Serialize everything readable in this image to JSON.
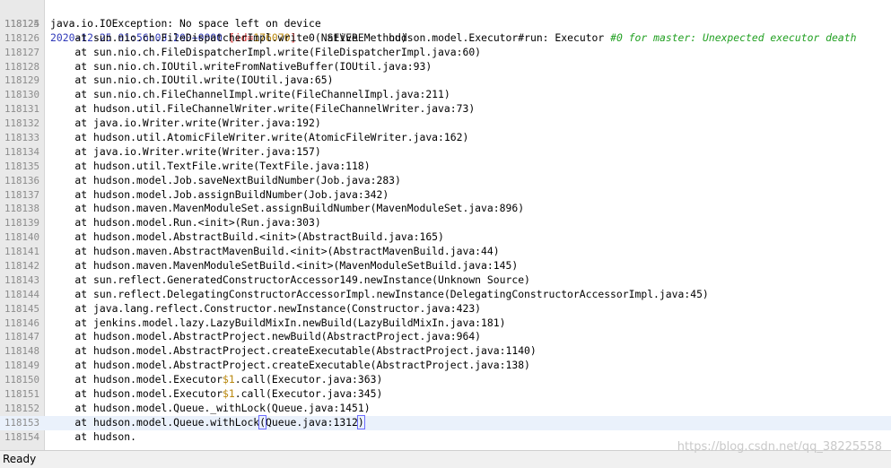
{
  "status": {
    "text": "Ready"
  },
  "watermark": "https://blog.csdn.net/qq_38225558",
  "header_line": {
    "num": "118124",
    "date": "2020-12-25 01:56:03.200+0000",
    "id_open": "[",
    "id_label": "id",
    "id_eq": "=",
    "id_value": "176070",
    "id_close": "]",
    "severity": "SEVERE",
    "source": "hudson.model.Executor#run: Executor ",
    "message": "#0 for master: Unexpected executor death"
  },
  "lines": [
    {
      "num": "118125",
      "code": "java.io.IOException: No space left on device"
    },
    {
      "num": "118126",
      "code": "    at sun.nio.ch.FileDispatcherImpl.write0(Native Method)"
    },
    {
      "num": "118127",
      "code": "    at sun.nio.ch.FileDispatcherImpl.write(FileDispatcherImpl.java:60)"
    },
    {
      "num": "118128",
      "code": "    at sun.nio.ch.IOUtil.writeFromNativeBuffer(IOUtil.java:93)"
    },
    {
      "num": "118129",
      "code": "    at sun.nio.ch.IOUtil.write(IOUtil.java:65)"
    },
    {
      "num": "118130",
      "code": "    at sun.nio.ch.FileChannelImpl.write(FileChannelImpl.java:211)"
    },
    {
      "num": "118131",
      "code": "    at hudson.util.FileChannelWriter.write(FileChannelWriter.java:73)"
    },
    {
      "num": "118132",
      "code": "    at java.io.Writer.write(Writer.java:192)"
    },
    {
      "num": "118133",
      "code": "    at hudson.util.AtomicFileWriter.write(AtomicFileWriter.java:162)"
    },
    {
      "num": "118134",
      "code": "    at java.io.Writer.write(Writer.java:157)"
    },
    {
      "num": "118135",
      "code": "    at hudson.util.TextFile.write(TextFile.java:118)"
    },
    {
      "num": "118136",
      "code": "    at hudson.model.Job.saveNextBuildNumber(Job.java:283)"
    },
    {
      "num": "118137",
      "code": "    at hudson.model.Job.assignBuildNumber(Job.java:342)"
    },
    {
      "num": "118138",
      "code": "    at hudson.maven.MavenModuleSet.assignBuildNumber(MavenModuleSet.java:896)"
    },
    {
      "num": "118139",
      "code": "    at hudson.model.Run.<init>(Run.java:303)"
    },
    {
      "num": "118140",
      "code": "    at hudson.model.AbstractBuild.<init>(AbstractBuild.java:165)"
    },
    {
      "num": "118141",
      "code": "    at hudson.maven.AbstractMavenBuild.<init>(AbstractMavenBuild.java:44)"
    },
    {
      "num": "118142",
      "code": "    at hudson.maven.MavenModuleSetBuild.<init>(MavenModuleSetBuild.java:145)"
    },
    {
      "num": "118143",
      "code": "    at sun.reflect.GeneratedConstructorAccessor149.newInstance(Unknown Source)"
    },
    {
      "num": "118144",
      "code": "    at sun.reflect.DelegatingConstructorAccessorImpl.newInstance(DelegatingConstructorAccessorImpl.java:45)"
    },
    {
      "num": "118145",
      "code": "    at java.lang.reflect.Constructor.newInstance(Constructor.java:423)"
    },
    {
      "num": "118146",
      "code": "    at jenkins.model.lazy.LazyBuildMixIn.newBuild(LazyBuildMixIn.java:181)"
    },
    {
      "num": "118147",
      "code": "    at hudson.model.AbstractProject.newBuild(AbstractProject.java:964)"
    },
    {
      "num": "118148",
      "code": "    at hudson.model.AbstractProject.createExecutable(AbstractProject.java:1140)"
    },
    {
      "num": "118149",
      "code": "    at hudson.model.AbstractProject.createExecutable(AbstractProject.java:138)"
    },
    {
      "num": "118150",
      "pre": "    at hudson.model.Executor",
      "hl": "$1",
      "post": ".call(Executor.java:363)"
    },
    {
      "num": "118151",
      "pre": "    at hudson.model.Executor",
      "hl": "$1",
      "post": ".call(Executor.java:345)"
    },
    {
      "num": "118152",
      "code": "    at hudson.model.Queue._withLock(Queue.java:1451)"
    },
    {
      "num": "118153",
      "current": true,
      "pre": "    at hudson.model.Queue.withLock",
      "box_open": "(",
      "post": "Queue.java:1312",
      "box_close": ")"
    },
    {
      "num": "118154",
      "code": "    at hudson."
    }
  ]
}
